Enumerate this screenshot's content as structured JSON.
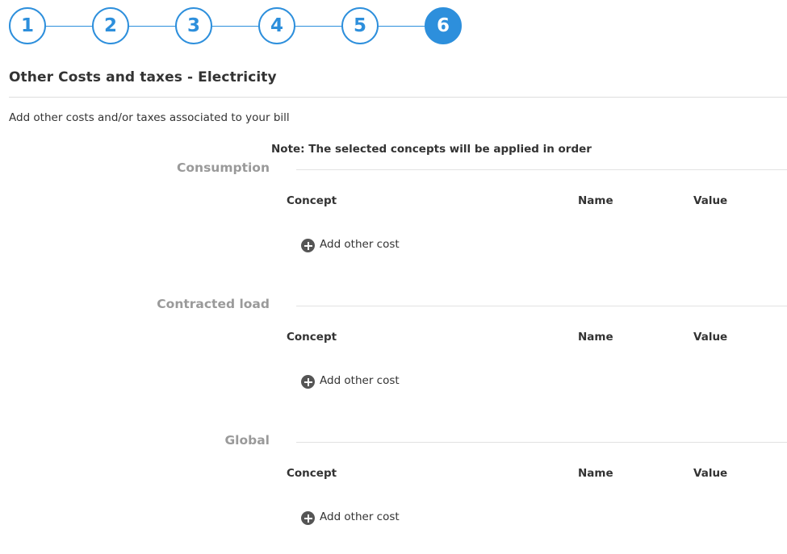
{
  "stepper": {
    "steps": [
      {
        "label": "1",
        "active": false
      },
      {
        "label": "2",
        "active": false
      },
      {
        "label": "3",
        "active": false
      },
      {
        "label": "4",
        "active": false
      },
      {
        "label": "5",
        "active": false
      },
      {
        "label": "6",
        "active": true
      }
    ],
    "accent_color": "#2d8fdc"
  },
  "header": {
    "title": "Other Costs and taxes - Electricity",
    "subtitle": "Add other costs and/or taxes associated to your bill",
    "note": "Note: The selected concepts will be applied in order"
  },
  "sections": [
    {
      "label": "Consumption",
      "columns": {
        "concept": "Concept",
        "name": "Name",
        "value": "Value"
      },
      "add_label": "Add other cost"
    },
    {
      "label": "Contracted load",
      "columns": {
        "concept": "Concept",
        "name": "Name",
        "value": "Value"
      },
      "add_label": "Add other cost"
    },
    {
      "label": "Global",
      "columns": {
        "concept": "Concept",
        "name": "Name",
        "value": "Value"
      },
      "add_label": "Add other cost"
    }
  ],
  "icons": {
    "add": "plus-circle-icon"
  }
}
